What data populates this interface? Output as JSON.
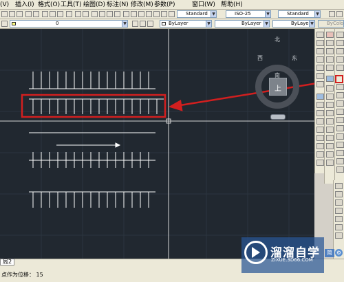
{
  "menu": {
    "items": [
      "(V)",
      "插入(I)",
      "格式(O)",
      "工具(T)",
      "绘图(D)",
      "标注(N)",
      "修改(M)",
      "参数(P)",
      "窗口(W)",
      "帮助(H)"
    ]
  },
  "toolbar": {
    "text_style": "Standard",
    "dim_style": "ISO-25",
    "table_style": "Standard",
    "layer": "0",
    "color": "ByLayer",
    "linetype": "ByLayer",
    "lineweight": "ByLayer",
    "plot_style": "ByColor"
  },
  "viewcube": {
    "face": "上",
    "north": "北",
    "south": "南",
    "east": "东",
    "west": "西"
  },
  "colors": {
    "canvas_bg": "#212830",
    "highlight_red": "#d21f1f",
    "parking_lines": "#ffffff"
  },
  "layout_tab": "局2",
  "command": {
    "prompt": "点作为位移：",
    "value": "15"
  },
  "watermark": {
    "title": "溜溜自学",
    "url": "ZIXUE.3D66.COM"
  },
  "bottom_right": {
    "label": "简"
  },
  "icons": [
    "ucs-icon",
    "viewcube-icon",
    "arrow-annotation",
    "move-tool-icon",
    "gear-icon"
  ]
}
